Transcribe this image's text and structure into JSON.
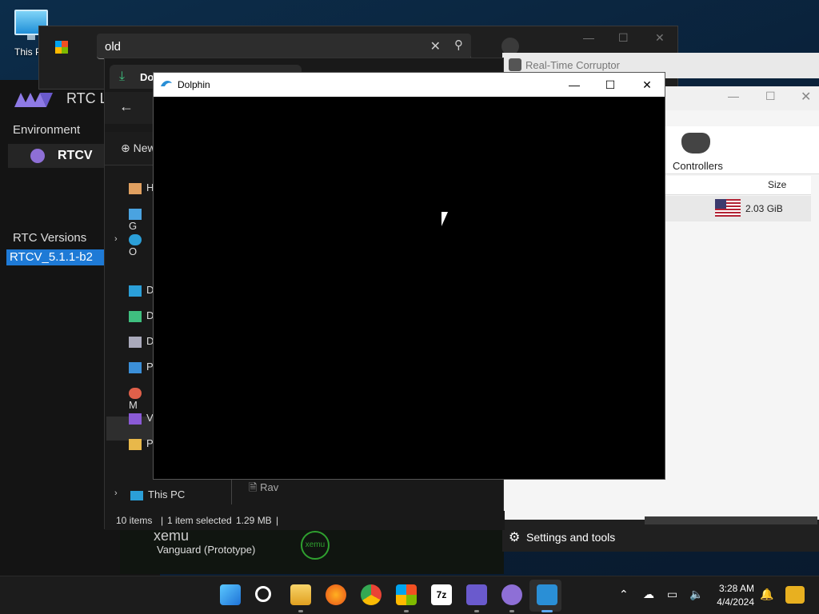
{
  "desktop": {
    "this_pc_label": "This P"
  },
  "rtc_launcher": {
    "title": "RTC La",
    "environment_label": "Environment",
    "environment_button": "RTCV",
    "versions_label": "RTC Versions",
    "versions": [
      "RTCV_5.1.1-b2"
    ]
  },
  "xemu": {
    "name": "xemu",
    "subtitle": "Vanguard (Prototype)",
    "logo_text": "xemu"
  },
  "store": {
    "search_value": "old"
  },
  "rtc_corruptor": {
    "title": "Real-Time Corruptor"
  },
  "dolphin_main": {
    "toolbar": {
      "controllers_label": "Controllers"
    },
    "table": {
      "size_header": "Size",
      "rows": [
        {
          "size": "2.03 GiB",
          "flag": "us-flag"
        }
      ]
    }
  },
  "settings_bar": {
    "label": "Settings and tools"
  },
  "explorer": {
    "tab_label": "Dov",
    "new_label": "New",
    "nav_items": [
      "H",
      "G",
      "O",
      "D",
      "D",
      "D",
      "P",
      "M",
      "V",
      "P"
    ],
    "this_pc": "This PC",
    "tab_rav": "Rav",
    "status": {
      "items": "10 items",
      "selected": "1 item selected",
      "size": "1.29 MB"
    }
  },
  "dolphin": {
    "title": "Dolphin"
  },
  "taskbar": {
    "time": "3:28 AM",
    "date": "4/4/2024"
  }
}
